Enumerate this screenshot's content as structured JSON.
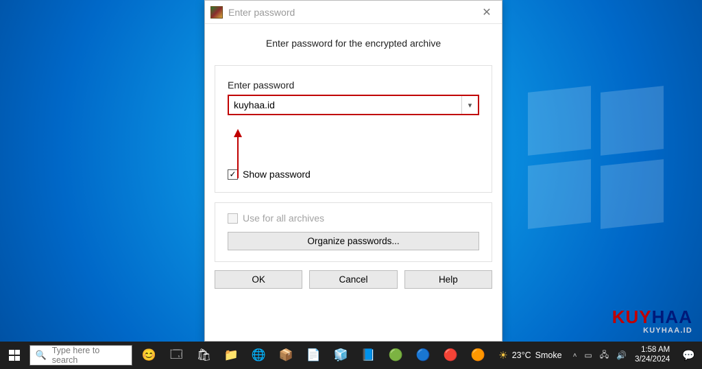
{
  "dialog": {
    "title": "Enter password",
    "heading": "Enter password for the encrypted archive",
    "password_label": "Enter password",
    "password_value": "kuyhaa.id",
    "show_password_label": "Show password",
    "show_password_checked": true,
    "use_for_all_label": "Use for all archives",
    "use_for_all_checked": false,
    "organize_label": "Organize passwords...",
    "ok_label": "OK",
    "cancel_label": "Cancel",
    "help_label": "Help"
  },
  "taskbar": {
    "search_placeholder": "Type here to search",
    "weather_temp": "23°C",
    "weather_desc": "Smoke",
    "time": "1:58 AM",
    "date": "3/24/2024"
  },
  "watermark": {
    "brand": "KUYHAA",
    "sub": "KUYHAA.ID"
  }
}
